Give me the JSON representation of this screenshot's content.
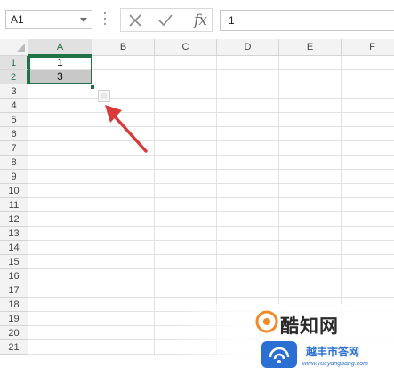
{
  "formula_bar": {
    "name_box": "A1",
    "cancel_icon": "x-icon",
    "enter_icon": "checkmark-icon",
    "function_label": "fx",
    "formula_value": "1"
  },
  "columns": [
    "A",
    "B",
    "C",
    "D",
    "E",
    "F"
  ],
  "rows": [
    "1",
    "2",
    "3",
    "4",
    "5",
    "6",
    "7",
    "8",
    "9",
    "10",
    "11",
    "12",
    "13",
    "14",
    "15",
    "16",
    "17",
    "18",
    "19",
    "20",
    "21"
  ],
  "cells": {
    "A1": "1",
    "A2": "3"
  },
  "annotation": {
    "arrow_color": "#d93a3a"
  },
  "watermark": {
    "brand_top": "酷知网",
    "brand_bottom": "越丰市答网",
    "url": "www.yueyangbang.com"
  },
  "colors": {
    "accent": "#217346",
    "header_bg": "#f3f3f3",
    "selected_fill": "#c8c8c8"
  }
}
